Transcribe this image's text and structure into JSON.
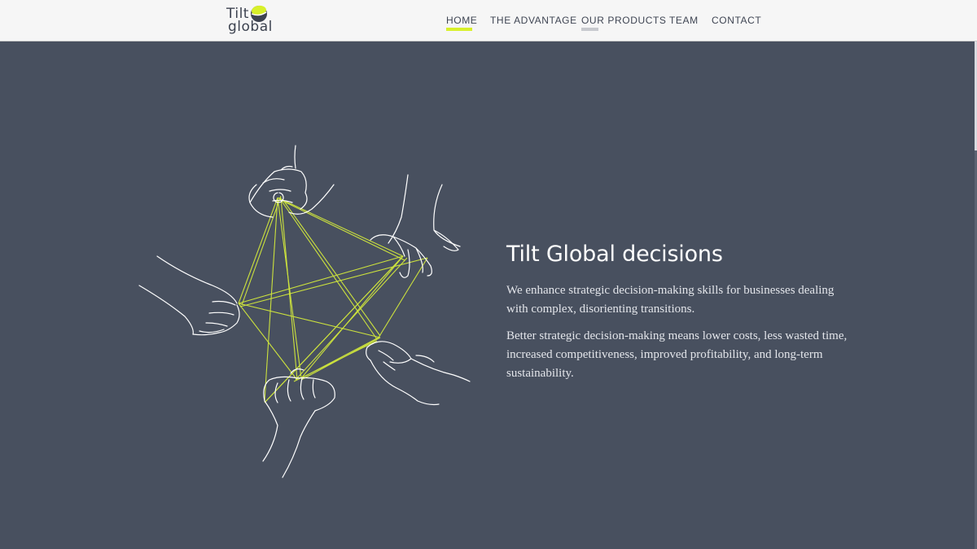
{
  "logo": {
    "line1": "Tilt",
    "line2": "global"
  },
  "nav": {
    "items": [
      {
        "label": "HOME",
        "state": "active"
      },
      {
        "label": "THE ADVANTAGE",
        "state": "normal"
      },
      {
        "label": "OUR PRODUCTS",
        "state": "hover"
      },
      {
        "label": "TEAM",
        "state": "normal"
      },
      {
        "label": "CONTACT",
        "state": "normal"
      }
    ]
  },
  "hero": {
    "title": "Tilt Global decisions",
    "paragraph1": "We enhance strategic decision-making skills for businesses dealing with complex, disorienting transitions.",
    "paragraph2": "Better strategic decision-making means lower costs, less wasted time, increased competitiveness, improved profitability, and long-term sustainability."
  },
  "colors": {
    "accent": "#d8f02a",
    "background": "#48505f",
    "topbar": "#f6f6f6",
    "string": "#d4ea3c",
    "hover_underline": "#c7c9ce"
  }
}
